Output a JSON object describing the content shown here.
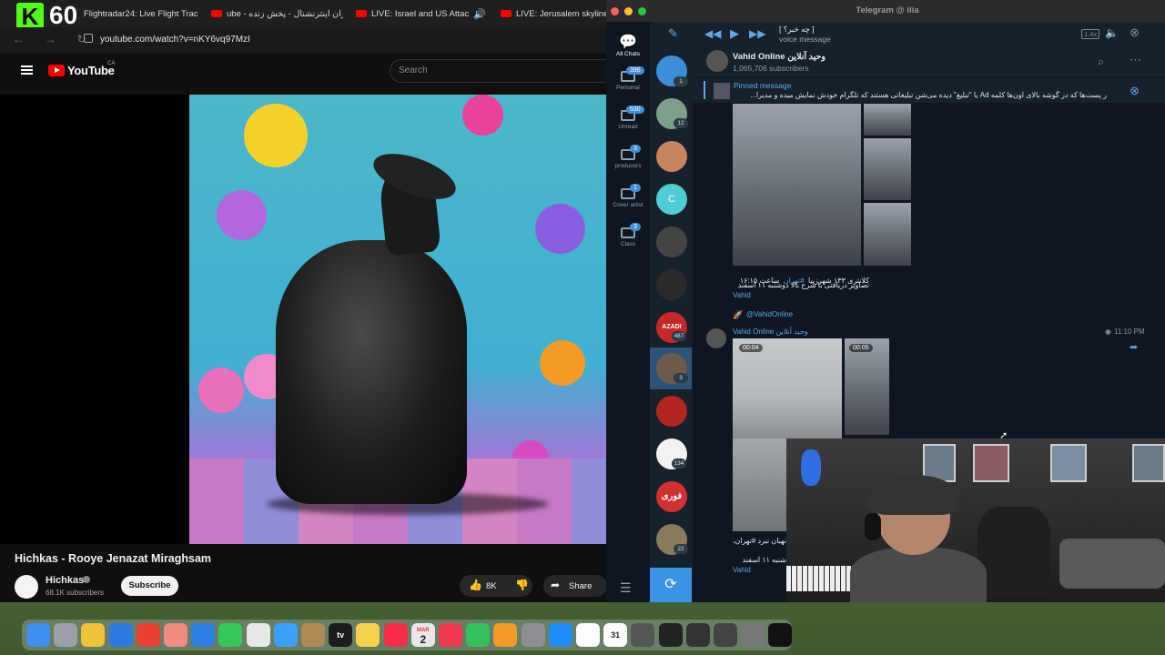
{
  "browser": {
    "stream_logo": "K",
    "stream_number": "60",
    "tabs": [
      {
        "label": "Flightradar24: Live Flight Trac"
      },
      {
        "label": "ube - ایران اینترنشنال - پخش زنده"
      },
      {
        "label": "LIVE: Israel and US Attac"
      },
      {
        "label": "LIVE: Jerusalem skyline as"
      }
    ],
    "url": "youtube.com/watch?v=nKY6vq97MzI"
  },
  "youtube": {
    "logo_text": "YouTube",
    "region": "CA",
    "search_placeholder": "Search",
    "video_title": "Hichkas - Rooye Jenazat Miraghsam",
    "channel_name": "Hichkas",
    "channel_subs": "68.1K subscribers",
    "subscribe_label": "Subscribe",
    "like_count": "8K",
    "share_label": "Share"
  },
  "telegram": {
    "window_title": "Telegram @ ilia",
    "folders": [
      {
        "label": "All Chats",
        "badge": ""
      },
      {
        "label": "Personal",
        "badge": "396"
      },
      {
        "label": "Unread",
        "badge": "530"
      },
      {
        "label": "producers",
        "badge": "3"
      },
      {
        "label": "Cover artist",
        "badge": "1"
      },
      {
        "label": "Class",
        "badge": "3"
      }
    ],
    "chat_badges": [
      "1",
      "12",
      "",
      "",
      "",
      "",
      "487",
      "3",
      "",
      "134",
      "",
      "22"
    ],
    "chat_avatar_labels": [
      "",
      "",
      "",
      "C",
      "",
      "",
      "AZADI",
      "",
      "",
      "",
      "فوری",
      ""
    ],
    "player": {
      "title": "[ چه خبر؟ ]",
      "subtitle": "voice message",
      "speed": "1.4x"
    },
    "channel": {
      "name": "Vahid Online وحید آنلاین",
      "subscribers": "1,065,706 subscribers"
    },
    "pinned": {
      "label": "Pinned message",
      "text": "ر پست‌ها که در گوشه بالای اون‌ها کلمه Ad یا \"تبلیغ\" دیده می‌شن تبلیغاتی هستند که تلگرام خودش نمایش میده و مدیرا..."
    },
    "messages": [
      {
        "caption_line1": "کلانتری ۱۳۳ شهرزیبا",
        "caption_hashtag": "#تهران",
        "caption_time_text": "ساعت ۱۶:۱۵",
        "caption_line2": "تصاویر دریافتی با شرح بالا دوشنبه ۱۱ اسفند",
        "signature": "Vahid"
      },
      {
        "handle": "@VahidOnline",
        "sender": "Vahid Online وحید آنلاین",
        "time": "11:10 PM",
        "video1_duration": "00:04",
        "video2_duration": "00:05",
        "caption_fragment": "نهبان نبرد #تهران،",
        "caption_line2": "شنبه ۱۱ اسفند",
        "signature": "Vahid"
      }
    ]
  },
  "colors": {
    "telegram_bg": "#17212b",
    "telegram_accent": "#3a95e8",
    "youtube_red": "#ff0000",
    "kick_green": "#53fc18"
  },
  "dock": {
    "icons": [
      "finder-icon",
      "launchpad-icon",
      "pencil-icon",
      "safari-icon",
      "chrome-icon",
      "photos-icon",
      "mail-icon",
      "facetime-icon",
      "reminders-icon",
      "freeform-icon",
      "folder-icon",
      "appletv-icon",
      "notes-icon",
      "music-icon",
      "calendar-icon",
      "news-icon",
      "numbers-icon",
      "pages-icon",
      "settings-icon",
      "appstore-icon",
      "notion-icon",
      "calendar31-icon",
      "vpn-icon",
      "logic-icon",
      "unity-icon",
      "obs-icon",
      "toolbox-icon",
      "capcut-icon"
    ],
    "calendar_month": "MAR",
    "calendar_day": "2",
    "calendar31": "31",
    "appletv_label": "tv"
  }
}
